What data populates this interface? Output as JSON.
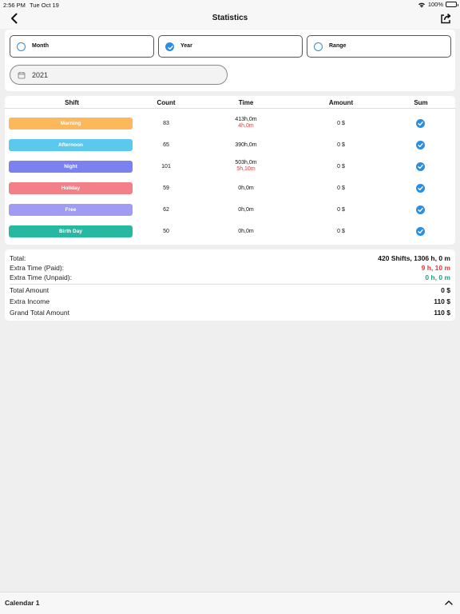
{
  "status": {
    "time": "2:56 PM",
    "date": "Tue Oct 19",
    "battery": "100%"
  },
  "nav": {
    "title": "Statistics"
  },
  "filter": {
    "options": [
      {
        "label": "Month",
        "selected": false
      },
      {
        "label": "Year",
        "selected": true
      },
      {
        "label": "Range",
        "selected": false
      }
    ],
    "date_value": "2021"
  },
  "table": {
    "headers": {
      "shift": "Shift",
      "count": "Count",
      "time": "Time",
      "amount": "Amount",
      "sum": "Sum"
    },
    "rows": [
      {
        "shift": "Morning",
        "color": "#fcb95c",
        "count": "83",
        "time": "413h,0m",
        "extra": "4h,0m",
        "amount": "0 $",
        "sum": true
      },
      {
        "shift": "Afternoon",
        "color": "#5bc8ee",
        "count": "65",
        "time": "390h,0m",
        "extra": "",
        "amount": "0 $",
        "sum": true
      },
      {
        "shift": "Night",
        "color": "#7b82f0",
        "count": "101",
        "time": "503h,0m",
        "extra": "5h,10m",
        "amount": "0 $",
        "sum": true
      },
      {
        "shift": "Holiday",
        "color": "#f38088",
        "count": "59",
        "time": "0h,0m",
        "extra": "",
        "amount": "0 $",
        "sum": true
      },
      {
        "shift": "Free",
        "color": "#a09cf4",
        "count": "62",
        "time": "0h,0m",
        "extra": "",
        "amount": "0 $",
        "sum": true
      },
      {
        "shift": "Birth Day",
        "color": "#27b8a2",
        "count": "50",
        "time": "0h,0m",
        "extra": "",
        "amount": "0 $",
        "sum": true
      }
    ]
  },
  "summary": {
    "total_label": "Total:",
    "total_value": "420 Shifts, 1306 h, 0 m",
    "extra_paid_label": "Extra Time (Paid):",
    "extra_paid_value": "9 h, 10 m",
    "extra_unpaid_label": "Extra Time (Unpaid):",
    "extra_unpaid_value": "0 h, 0 m",
    "total_amount_label": "Total Amount",
    "total_amount_value": "0 $",
    "extra_income_label": "Extra Income",
    "extra_income_value": "110 $",
    "grand_total_label": "Grand Total Amount",
    "grand_total_value": "110 $"
  },
  "bottom": {
    "label": "Calendar 1"
  },
  "colors": {
    "accent": "#2b8fe0",
    "red": "#e03a3a",
    "green": "#1fa37a"
  }
}
